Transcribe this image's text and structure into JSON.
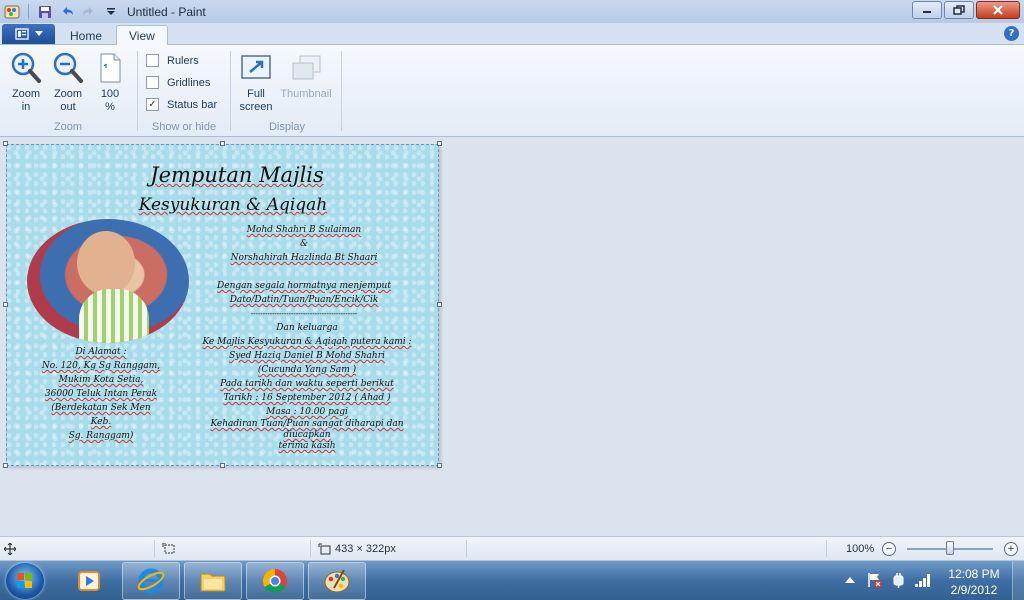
{
  "window": {
    "title": "Untitled - Paint"
  },
  "tabs": {
    "home": "Home",
    "view": "View"
  },
  "ribbon": {
    "zoom_in": [
      "Zoom",
      "in"
    ],
    "zoom_out": [
      "Zoom",
      "out"
    ],
    "hundred": [
      "100",
      "%"
    ],
    "zoom_group": "Zoom",
    "rulers": "Rulers",
    "gridlines": "Gridlines",
    "statusbar": "Status bar",
    "showhide_group": "Show or hide",
    "fullscreen": [
      "Full",
      "screen"
    ],
    "thumbnail": "Thumbnail",
    "display_group": "Display",
    "checks": {
      "rulers": false,
      "gridlines": false,
      "statusbar": true
    }
  },
  "card": {
    "title": "Jemputan Majlis",
    "subtitle": "Kesyukuran & Aqiqah",
    "hosts": [
      "Mohd Shahri B Sulaiman",
      "&",
      "Norshahirah Hazlinda Bt Shaari"
    ],
    "invite": [
      "Dengan segala hormatnya menjemput",
      "Dato/Datin/Tuan/Puan/Encik/Cik"
    ],
    "divider": "---------------------------------------------",
    "details": [
      "Dan keluarga",
      "Ke Majlis Kesyukuran & Aqiqah putera kami :",
      "Syed Haziq Daniel B Mohd Shahri",
      "(Cucunda Yang Sam )",
      "Pada tarikh dan waktu seperti berikut",
      "Tarikh : 16 September 2012 ( Ahad )",
      "Masa : 10.00 pagi",
      "Kehadiran Tuan/Puan sangat diharapi dan diucapkan",
      "terima kasih"
    ],
    "address": [
      "Di Alamat :",
      "No. 120, Kg Sg Ranggam,",
      "Mukim Kota Setia,",
      "36000 Teluk Intan Perak",
      "(Berdekatan Sek Men",
      "Keb.",
      "Sg. Ranggam)"
    ]
  },
  "statusbar": {
    "dimensions": "433 × 322px",
    "zoom": "100%",
    "zoom_level": 1.0
  },
  "taskbar": {
    "time": "12:08 PM",
    "date": "2/9/2012"
  },
  "colors": {
    "accent": "#1d4f9a",
    "canvas_bg": "#a9dceb",
    "taskbar": "#3f6ea4"
  }
}
